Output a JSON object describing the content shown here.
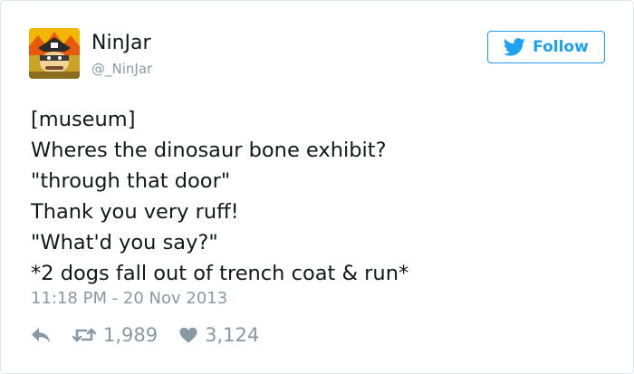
{
  "user": {
    "display_name": "NinJar",
    "screen_name": "@_NinJar",
    "avatar_icon": "pirate-ninja-avatar"
  },
  "follow_button": {
    "label": "Follow",
    "icon": "twitter-bird-icon",
    "color": "#1da1f2"
  },
  "tweet": {
    "lines": [
      "[museum]",
      "Wheres the dinosaur bone exhibit?",
      "\"through that door\"",
      "Thank you very ruff!",
      "\"What'd you say?\"",
      "*2 dogs fall out of trench coat & run*"
    ],
    "timestamp": "11:18 PM - 20 Nov 2013"
  },
  "actions": {
    "reply_icon": "reply-icon",
    "retweet_icon": "retweet-icon",
    "retweet_count": "1,989",
    "like_icon": "heart-icon",
    "like_count": "3,124"
  },
  "colors": {
    "text": "#14171a",
    "muted": "#8899a6",
    "accent": "#1da1f2",
    "border": "#e1e8ed"
  }
}
